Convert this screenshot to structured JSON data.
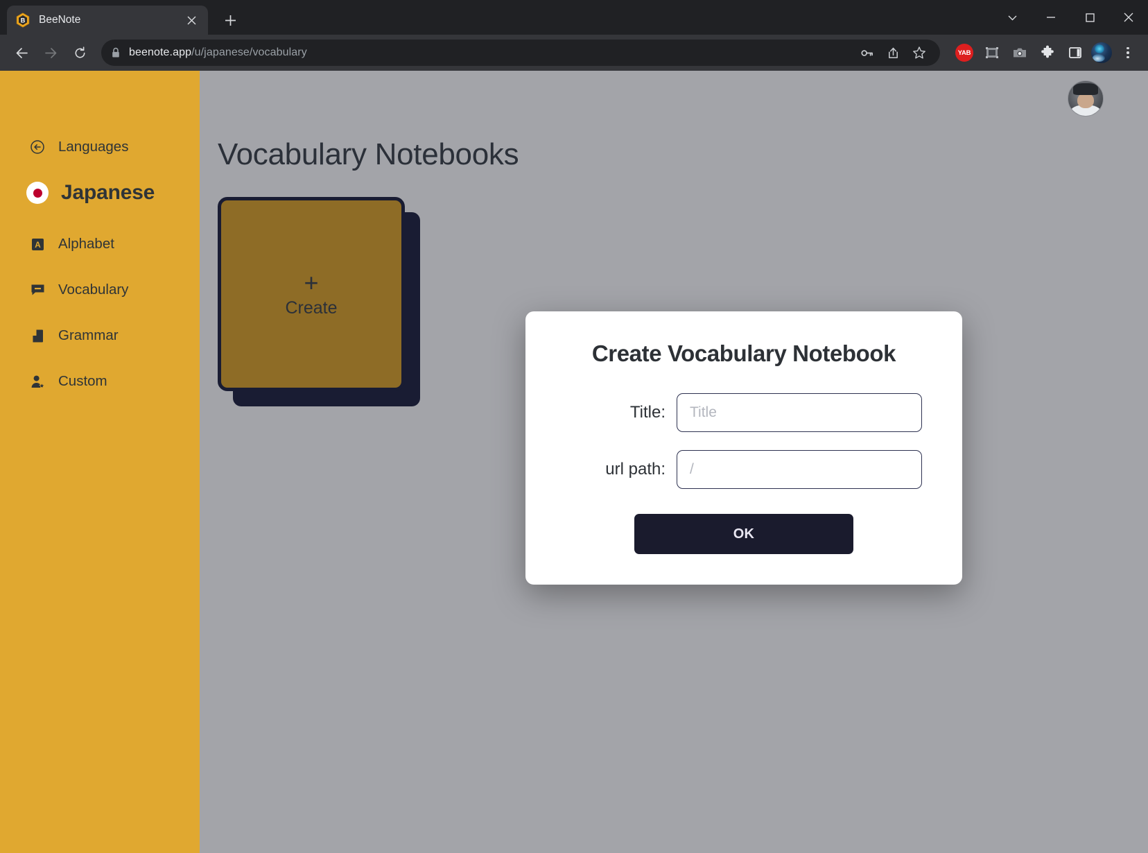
{
  "browser": {
    "tab": {
      "title": "BeeNote",
      "favicon_icon": "beenote-hexagon-b-icon",
      "close_icon": "close-icon"
    },
    "new_tab_icon": "plus-icon",
    "window_controls": [
      {
        "name": "tab-search",
        "icon": "chevron-down-icon",
        "glyph": "⌄"
      },
      {
        "name": "minimize",
        "icon": "minimize-icon",
        "glyph": "—"
      },
      {
        "name": "maximize",
        "icon": "maximize-icon",
        "glyph": "□"
      },
      {
        "name": "close",
        "icon": "close-icon",
        "glyph": "✕"
      }
    ],
    "nav": {
      "back_icon": "back-arrow-icon",
      "forward_icon": "forward-arrow-icon",
      "reload_icon": "reload-icon"
    },
    "omnibox": {
      "lock_icon": "lock-icon",
      "host": "beenote.app",
      "path": "/u/japanese/vocabulary",
      "full_url": "beenote.app/u/japanese/vocabulary"
    },
    "omnibox_actions": [
      {
        "name": "password-manager",
        "icon": "key-icon"
      },
      {
        "name": "share",
        "icon": "share-icon"
      },
      {
        "name": "bookmark",
        "icon": "star-icon"
      }
    ],
    "extensions": [
      {
        "name": "yab-extension",
        "icon": "yab-badge-icon",
        "label": "YAB"
      },
      {
        "name": "screenshot-region-extension",
        "icon": "screen-capture-icon"
      },
      {
        "name": "camera-extension",
        "icon": "camera-icon"
      },
      {
        "name": "extensions-menu",
        "icon": "puzzle-piece-icon"
      },
      {
        "name": "side-panel",
        "icon": "side-panel-icon"
      }
    ],
    "profile_icon": "browser-profile-avatar",
    "menu_icon": "kebab-menu-icon"
  },
  "sidebar": {
    "background_color": "#e0a830",
    "items": [
      {
        "label": "Languages",
        "icon": "back-circle-icon",
        "current": false
      },
      {
        "label": "Japanese",
        "icon": "japan-flag-icon",
        "current": true
      },
      {
        "label": "Alphabet",
        "icon": "letter-a-square-icon",
        "current": false
      },
      {
        "label": "Vocabulary",
        "icon": "speech-bubble-icon",
        "current": false
      },
      {
        "label": "Grammar",
        "icon": "book-icon",
        "current": false
      },
      {
        "label": "Custom",
        "icon": "person-star-icon",
        "current": false
      }
    ]
  },
  "main": {
    "page_title": "Vocabulary Notebooks",
    "user_avatar_icon": "user-avatar",
    "create_card": {
      "plus": "+",
      "label": "Create",
      "fill_color": "#8e6c26",
      "border_color": "#191c33"
    },
    "background_color": "#a3a4a9"
  },
  "modal": {
    "title": "Create Vocabulary Notebook",
    "fields": [
      {
        "label": "Title:",
        "value": "",
        "placeholder": "Title",
        "name": "title"
      },
      {
        "label": "url path:",
        "value": "",
        "placeholder": "/",
        "name": "url-path"
      }
    ],
    "ok_label": "OK",
    "ok_color": "#1a1b2d"
  }
}
